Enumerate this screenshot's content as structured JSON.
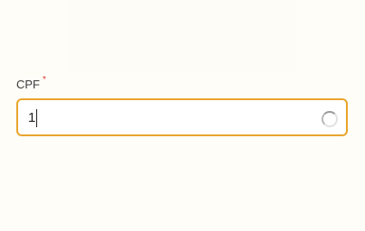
{
  "form": {
    "cpf_field": {
      "label": "CPF",
      "required_mark": "*",
      "value": "1",
      "state": "loading",
      "accent_color": "#e8a52c",
      "required_color": "#e0322f"
    }
  }
}
